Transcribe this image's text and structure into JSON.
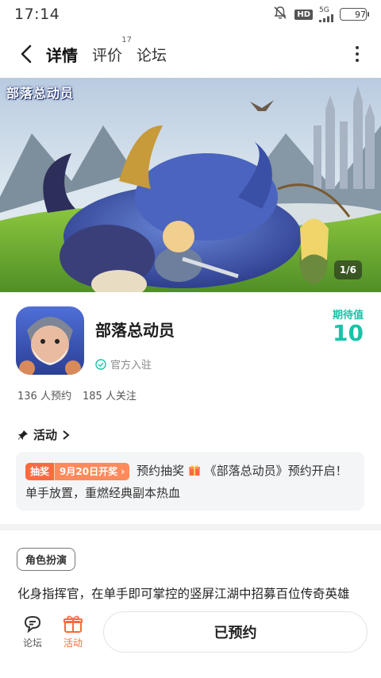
{
  "status_bar": {
    "time": "17:14",
    "hd_badge": "HD",
    "network": "5G",
    "battery": "97"
  },
  "nav": {
    "tabs": [
      {
        "label": "详情",
        "active": true
      },
      {
        "label": "评价",
        "count": "17"
      },
      {
        "label": "论坛"
      }
    ]
  },
  "banner": {
    "logo_text": "部落总动员",
    "page_indicator": "1/6"
  },
  "game": {
    "title": "部落总动员",
    "official_label": "官方入驻",
    "expect_label": "期待值",
    "expect_value": "10",
    "reservations": "136 人预约",
    "follows": "185 人关注"
  },
  "activity": {
    "heading": "活动",
    "tag_type": "抽奖",
    "tag_date": "9月20日开奖",
    "text_before": "预约抽奖",
    "text_after": "《部落总动员》预约开启！单手放置，重燃经典副本热血"
  },
  "genre": {
    "tag": "角色扮演",
    "description": "化身指挥官，在单手即可掌控的竖屏江湖中招募百位传奇英雄"
  },
  "bottom_bar": {
    "forum_label": "论坛",
    "activity_label": "活动",
    "reserve_button": "已预约"
  },
  "colors": {
    "accent": "#16c4a8",
    "tab_underline": "#2fd7c9",
    "orange": "#ff6a3d"
  }
}
